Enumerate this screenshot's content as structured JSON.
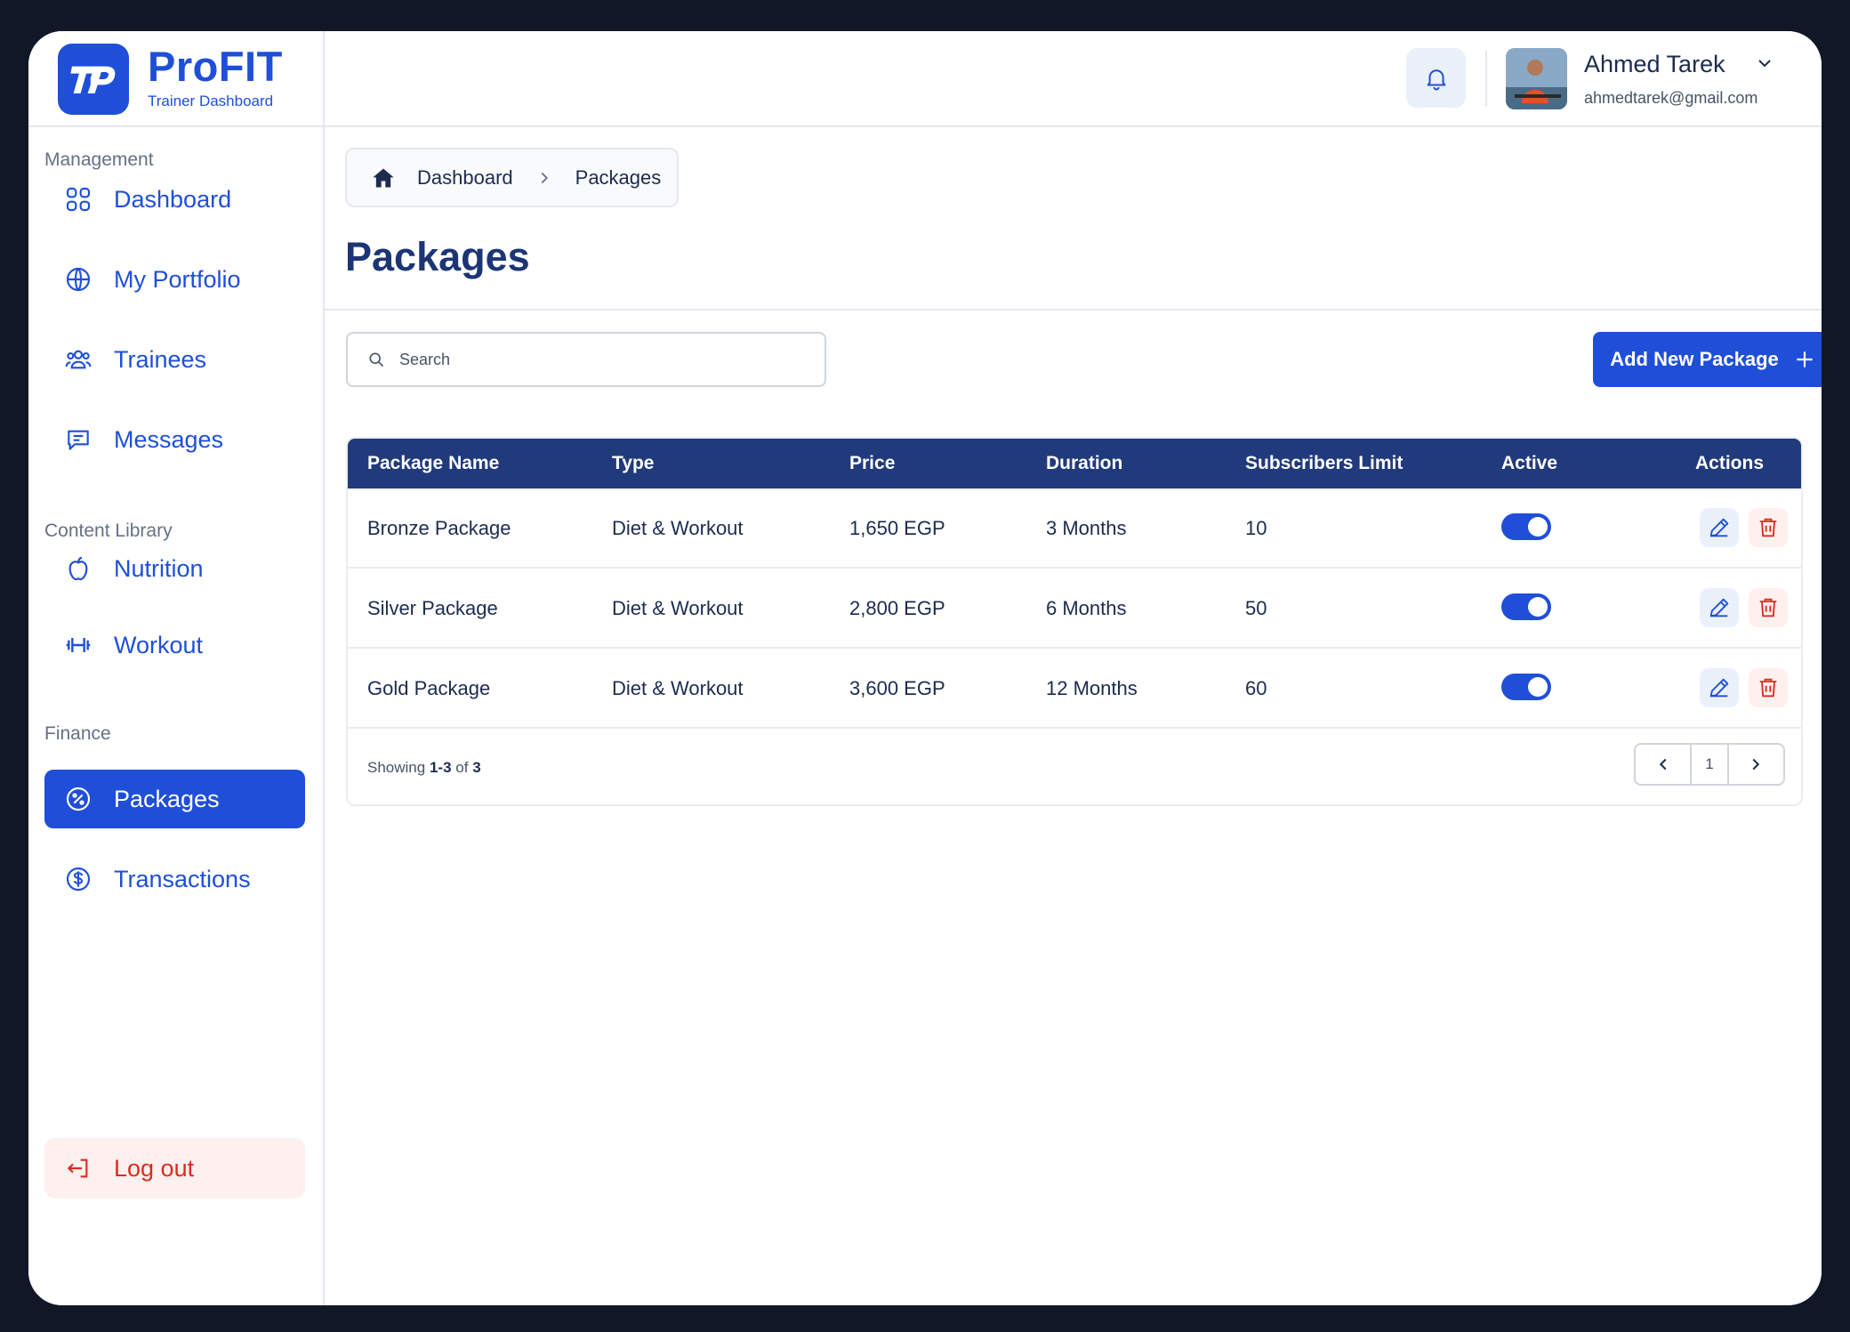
{
  "brand": {
    "name": "ProFIT",
    "subtitle": "Trainer Dashboard"
  },
  "sidebar": {
    "sections": [
      {
        "label": "Management"
      },
      {
        "label": "Content Library"
      },
      {
        "label": "Finance"
      }
    ],
    "items": [
      {
        "label": "Dashboard",
        "icon": "grid-icon"
      },
      {
        "label": "My Portfolio",
        "icon": "globe-icon"
      },
      {
        "label": "Trainees",
        "icon": "users-icon"
      },
      {
        "label": "Messages",
        "icon": "chat-icon"
      },
      {
        "label": "Nutrition",
        "icon": "apple-icon"
      },
      {
        "label": "Workout",
        "icon": "dumbbell-icon"
      },
      {
        "label": "Packages",
        "icon": "percent-badge-icon",
        "active": true
      },
      {
        "label": "Transactions",
        "icon": "dollar-circle-icon"
      }
    ],
    "logout_label": "Log out"
  },
  "header": {
    "user": {
      "name": "Ahmed Tarek",
      "email": "ahmedtarek@gmail.com"
    }
  },
  "breadcrumb": {
    "items": [
      "Dashboard",
      "Packages"
    ]
  },
  "page": {
    "title": "Packages"
  },
  "search": {
    "placeholder": "Search"
  },
  "add_button": {
    "label": "Add New Package"
  },
  "table": {
    "columns": [
      "Package Name",
      "Type",
      "Price",
      "Duration",
      "Subscribers Limit",
      "Active",
      "Actions"
    ],
    "rows": [
      {
        "name": "Bronze Package",
        "type": "Diet & Workout",
        "price": "1,650 EGP",
        "duration": "3 Months",
        "limit": "10",
        "active": true
      },
      {
        "name": "Silver Package",
        "type": "Diet & Workout",
        "price": "2,800 EGP",
        "duration": "6 Months",
        "limit": "50",
        "active": true
      },
      {
        "name": "Gold Package",
        "type": "Diet & Workout",
        "price": "3,600 EGP",
        "duration": "12 Months",
        "limit": "60",
        "active": true
      }
    ]
  },
  "pagination": {
    "showing_prefix": "Showing",
    "range": "1-3",
    "of_word": "of",
    "total": "3",
    "current_page": "1"
  },
  "colors": {
    "primary": "#1f4fd8",
    "header_bg": "#213a7c",
    "danger": "#d92d20",
    "title": "#1d3575"
  }
}
